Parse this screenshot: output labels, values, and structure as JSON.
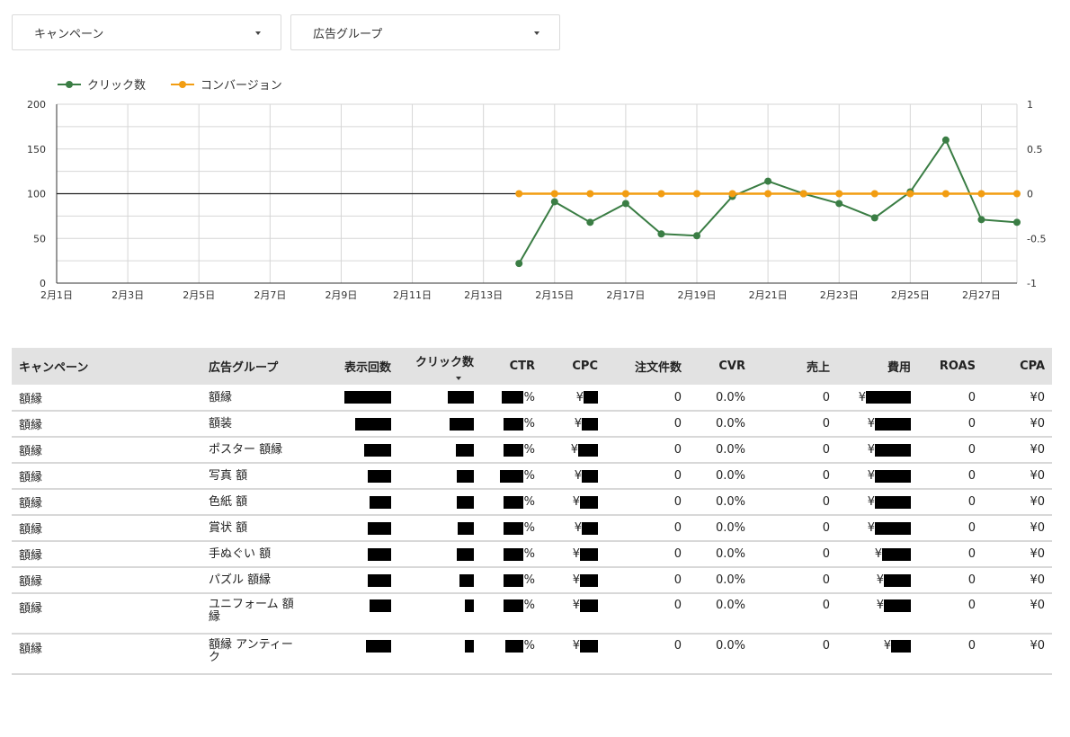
{
  "filters": {
    "campaign_label": "キャンペーン",
    "adgroup_label": "広告グループ"
  },
  "chart_data": {
    "type": "line",
    "legend_position": "top-left",
    "grid": true,
    "x": [
      "2月1日",
      "2月2日",
      "2月3日",
      "2月4日",
      "2月5日",
      "2月6日",
      "2月7日",
      "2月8日",
      "2月9日",
      "2月10日",
      "2月11日",
      "2月12日",
      "2月13日",
      "2月14日",
      "2月15日",
      "2月16日",
      "2月17日",
      "2月18日",
      "2月19日",
      "2月20日",
      "2月21日",
      "2月22日",
      "2月23日",
      "2月24日",
      "2月25日",
      "2月26日",
      "2月27日",
      "2月28日"
    ],
    "x_tick_labels": [
      "2月1日",
      "2月3日",
      "2月5日",
      "2月7日",
      "2月9日",
      "2月11日",
      "2月13日",
      "2月15日",
      "2月17日",
      "2月19日",
      "2月21日",
      "2月23日",
      "2月25日",
      "2月27日"
    ],
    "y_left": {
      "lim": [
        0,
        200
      ],
      "ticks": [
        "0",
        "50",
        "100",
        "150",
        "200"
      ]
    },
    "y_right": {
      "lim": [
        -1,
        1
      ],
      "ticks": [
        "-1",
        "-0.5",
        "0",
        "0.5",
        "1"
      ]
    },
    "series": [
      {
        "name": "クリック数",
        "color": "#3a7d44",
        "axis": "left",
        "values": [
          null,
          null,
          null,
          null,
          null,
          null,
          null,
          null,
          null,
          null,
          null,
          null,
          null,
          22,
          91,
          68,
          89,
          55,
          53,
          97,
          114,
          100,
          89,
          73,
          102,
          160,
          71,
          68
        ]
      },
      {
        "name": "コンバージョン",
        "color": "#f29d12",
        "axis": "right",
        "values": [
          null,
          null,
          null,
          null,
          null,
          null,
          null,
          null,
          null,
          null,
          null,
          null,
          null,
          0,
          0,
          0,
          0,
          0,
          0,
          0,
          0,
          0,
          0,
          0,
          0,
          0,
          0,
          0
        ]
      }
    ]
  },
  "table": {
    "headers": [
      "キャンペーン",
      "広告グループ",
      "表示回数",
      "クリック数",
      "CTR",
      "CPC",
      "注文件数",
      "CVR",
      "売上",
      "費用",
      "ROAS",
      "CPA"
    ],
    "rows": [
      {
        "campaign": "額縁",
        "adgroup": "額縁",
        "orders": "0",
        "cvr": "0.0%",
        "sales": "0",
        "roas": "0",
        "cpa": "¥0"
      },
      {
        "campaign": "額縁",
        "adgroup": "額装",
        "orders": "0",
        "cvr": "0.0%",
        "sales": "0",
        "roas": "0",
        "cpa": "¥0"
      },
      {
        "campaign": "額縁",
        "adgroup": "ポスター 額縁",
        "orders": "0",
        "cvr": "0.0%",
        "sales": "0",
        "roas": "0",
        "cpa": "¥0"
      },
      {
        "campaign": "額縁",
        "adgroup": "写真 額",
        "orders": "0",
        "cvr": "0.0%",
        "sales": "0",
        "roas": "0",
        "cpa": "¥0"
      },
      {
        "campaign": "額縁",
        "adgroup": "色紙 額",
        "orders": "0",
        "cvr": "0.0%",
        "sales": "0",
        "roas": "0",
        "cpa": "¥0"
      },
      {
        "campaign": "額縁",
        "adgroup": "賞状 額",
        "orders": "0",
        "cvr": "0.0%",
        "sales": "0",
        "roas": "0",
        "cpa": "¥0"
      },
      {
        "campaign": "額縁",
        "adgroup": "手ぬぐい 額",
        "orders": "0",
        "cvr": "0.0%",
        "sales": "0",
        "roas": "0",
        "cpa": "¥0"
      },
      {
        "campaign": "額縁",
        "adgroup": "パズル 額縁",
        "orders": "0",
        "cvr": "0.0%",
        "sales": "0",
        "roas": "0",
        "cpa": "¥0"
      },
      {
        "campaign": "額縁",
        "adgroup": "ユニフォーム 額縁",
        "orders": "0",
        "cvr": "0.0%",
        "sales": "0",
        "roas": "0",
        "cpa": "¥0"
      },
      {
        "campaign": "額縁",
        "adgroup": "額縁 アンティーク",
        "orders": "0",
        "cvr": "0.0%",
        "sales": "0",
        "roas": "0",
        "cpa": "¥0"
      }
    ],
    "ctr_suffix": "%",
    "yen_symbol": "¥"
  }
}
